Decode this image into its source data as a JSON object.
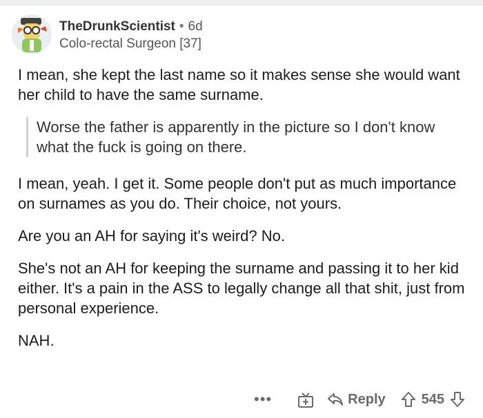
{
  "comment": {
    "username": "TheDrunkScientist",
    "separator": "•",
    "age": "6d",
    "flair": "Colo-rectal Surgeon [37]",
    "paragraph1": "I mean, she kept the last name so it makes sense she would want her child to have the same surname.",
    "quote": "Worse the father is apparently in the picture so I don't know what the fuck is going on there.",
    "paragraph2": "I mean, yeah.  I get it.  Some people don't put as much importance on surnames as you do.  Their choice, not yours.",
    "paragraph3": "Are you an AH for saying it's weird? No.",
    "paragraph4": "She's not an AH for keeping the surname and passing it to her kid either.  It's a pain in the ASS to legally change all that shit, just from personal experience.",
    "paragraph5": "NAH."
  },
  "actions": {
    "more_label": "•••",
    "award_icon": "gift-plus-icon",
    "reply_icon": "reply-arrow-icon",
    "reply_label": "Reply",
    "upvote_icon": "upvote-arrow-icon",
    "score": "545",
    "downvote_icon": "downvote-arrow-icon"
  }
}
